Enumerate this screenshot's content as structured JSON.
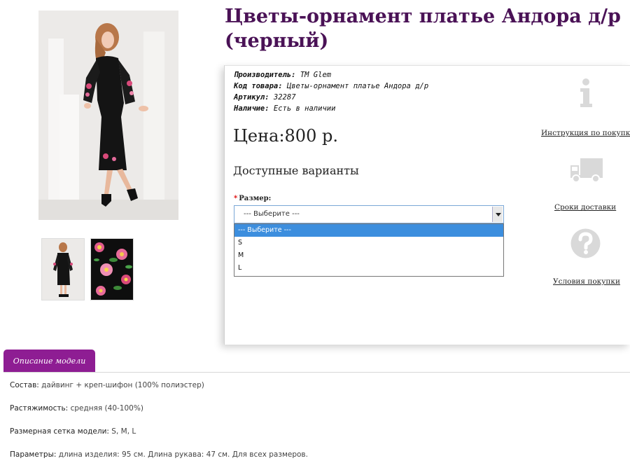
{
  "product": {
    "title": "Цветы-орнамент платье Андора д/р (черный)",
    "specs": [
      {
        "key": "Производитель:",
        "value": "TM Glem"
      },
      {
        "key": "Код товара:",
        "value": "Цветы-орнамент платье Андора д/р"
      },
      {
        "key": "Артикул:",
        "value": "32287"
      },
      {
        "key": "Наличие:",
        "value": "Есть в наличии"
      }
    ],
    "price": "Цена:800 р.",
    "options_heading": "Доступные варианты"
  },
  "size_select": {
    "label": "Размер:",
    "required_mark": "*",
    "selected": "--- Выберите ---",
    "options": [
      "--- Выберите ---",
      "S",
      "M",
      "L"
    ]
  },
  "side_links": {
    "instruction": "Инструкция по покупке",
    "delivery": "Сроки доставки",
    "terms": "Условия покупки"
  },
  "tab": {
    "label": "Описание модели"
  },
  "description": [
    {
      "key": "Состав:",
      "value": "дайвинг + креп-шифон (100% полиэстер)"
    },
    {
      "key": "Растяжимость:",
      "value": "средняя (40-100%)"
    },
    {
      "key": "Размерная сетка модели:",
      "value": "S, M, L"
    },
    {
      "key": "Параметры:",
      "value": "длина изделия: 95 см. Длина рукава: 47 см. Для всех размеров."
    }
  ],
  "icons": {
    "info": "info-icon",
    "truck": "truck-icon",
    "question": "question-icon"
  },
  "colors": {
    "title": "#4a1256",
    "tab_bg": "#8e1d93",
    "select_highlight": "#3c8ede"
  }
}
